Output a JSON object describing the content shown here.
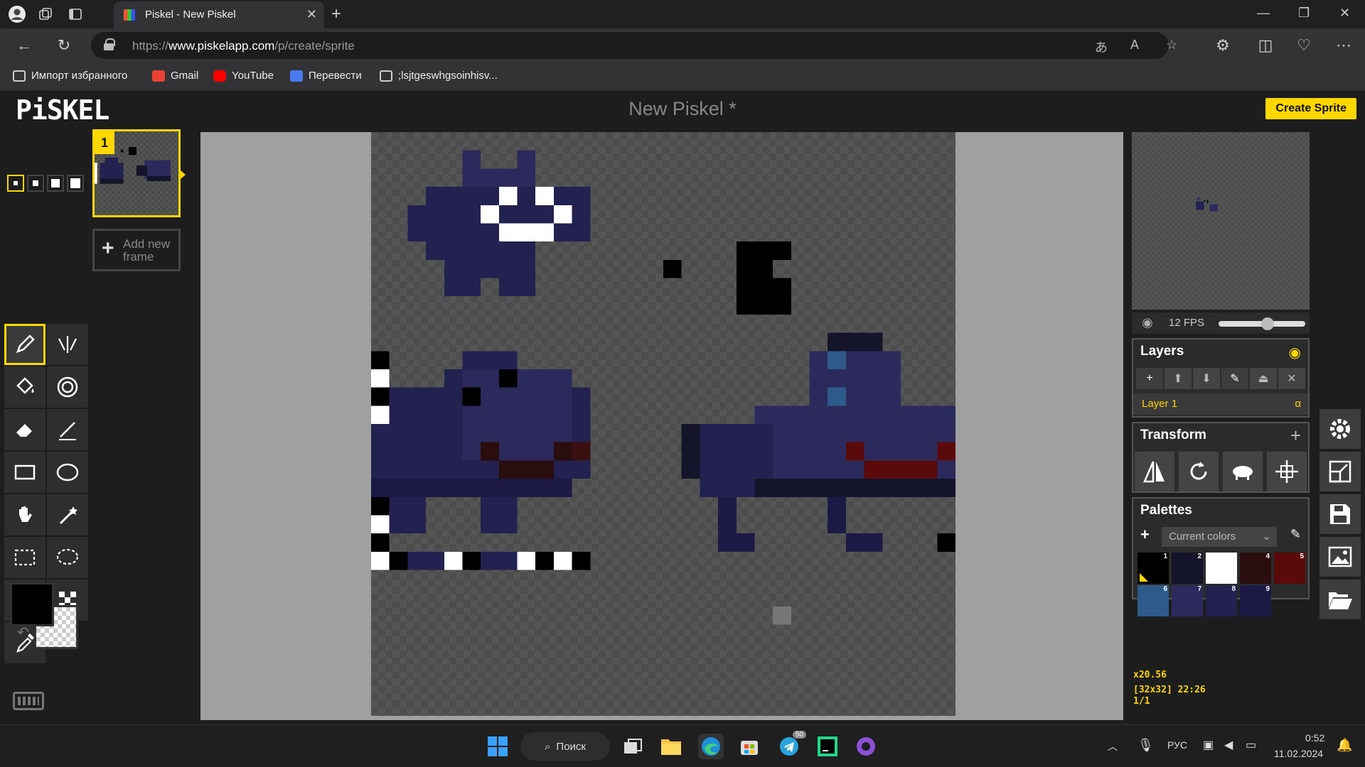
{
  "browser": {
    "tab_title": "Piskel - New Piskel",
    "url_prefix": "https://",
    "url_domain": "www.piskelapp.com",
    "url_path": "/p/create/sprite",
    "bookmarks": [
      {
        "label": "Импорт избранного",
        "icon": "import-icon",
        "color": "#cccccc"
      },
      {
        "label": "Gmail",
        "icon": "gmail-icon",
        "color": "#ea4335"
      },
      {
        "label": "YouTube",
        "icon": "youtube-icon",
        "color": "#ff0000"
      },
      {
        "label": "Перевести",
        "icon": "translate-icon",
        "color": "#4a7cf0"
      },
      {
        "label": ";lsjtgeswhgsoinhisv...",
        "icon": "page-icon",
        "color": "#cccccc"
      }
    ]
  },
  "app": {
    "logo": "PiSKEL",
    "title": "New Piskel *",
    "create_button": "Create Sprite",
    "accent": "#ffd700",
    "frame_number": "1",
    "add_frame_label": "Add new frame",
    "fps_label": "12 FPS",
    "fps_value": 12,
    "layers": {
      "title": "Layers",
      "layer_name": "Layer 1",
      "alpha_symbol": "α"
    },
    "transform": {
      "title": "Transform"
    },
    "palettes": {
      "title": "Palettes",
      "selected": "Current colors",
      "swatches": [
        {
          "num": "1",
          "color": "#000000"
        },
        {
          "num": "2",
          "color": "#14142b"
        },
        {
          "num": "3",
          "color": "#ffffff"
        },
        {
          "num": "4",
          "color": "#2a0d0d"
        },
        {
          "num": "5",
          "color": "#5a0a0a"
        },
        {
          "num": "6",
          "color": "#2e5a8a"
        },
        {
          "num": "7",
          "color": "#2c2a5c"
        },
        {
          "num": "8",
          "color": "#23214f"
        },
        {
          "num": "9",
          "color": "#1c1a45"
        }
      ]
    },
    "status": {
      "zoom": "x20.56",
      "size_cursor": "[32x32] 22:26",
      "frame": "1/1"
    }
  },
  "taskbar": {
    "search_label": "Поиск",
    "telegram_badge": "50",
    "lang": "РУС",
    "time": "0:52",
    "date": "11.02.2024"
  }
}
